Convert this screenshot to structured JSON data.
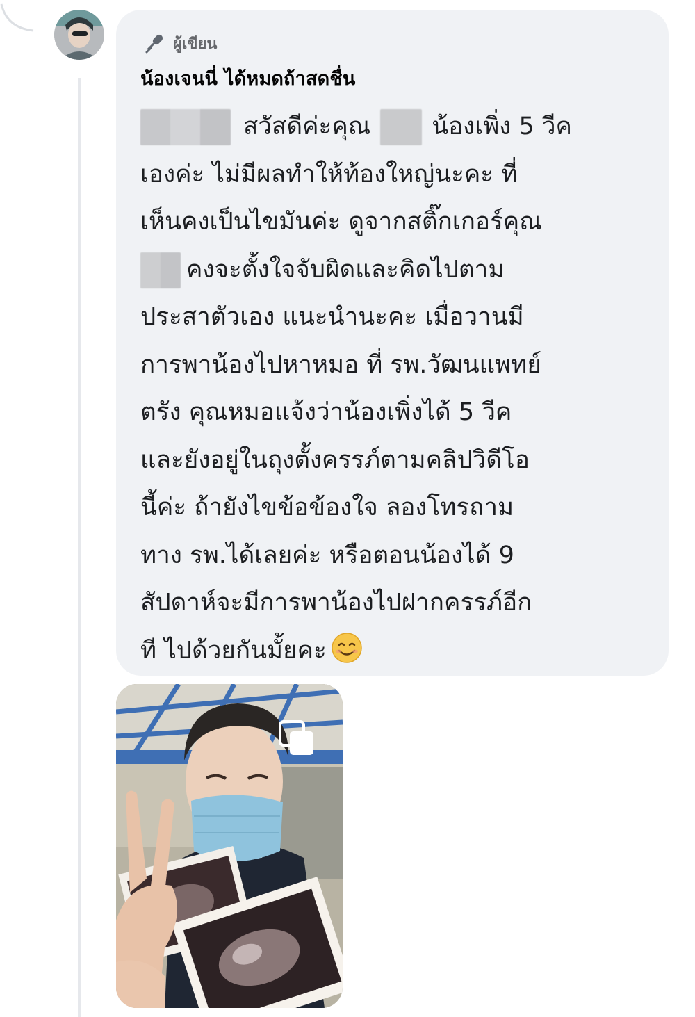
{
  "comment": {
    "author_badge": "ผู้เขียน",
    "author_name": "น้องเจนนี่ ได้หมดถ้าสดชื่น",
    "lines": [
      {
        "before_redaction": "",
        "text": "สวัสดีค่ะคุณ"
      },
      {
        "text": "น้องเพิ่ง 5 วีค"
      },
      {
        "text": "เองค่ะ ไม่มีผลทำให้ท้องใหญ่นะคะ ที่"
      },
      {
        "text": "เห็นคงเป็นไขมันค่ะ ดูจากสติ๊กเกอร์คุณ"
      },
      {
        "text": "คงจะตั้งใจจับผิดและคิดไปตาม"
      },
      {
        "text": "ประสาตัวเอง แนะนำนะคะ เมื่อวานมี"
      },
      {
        "text": "การพาน้องไปหาหมอ ที่ รพ.วัฒนแพทย์"
      },
      {
        "text": "ตรัง คุณหมอแจ้งว่าน้องเพิ่งได้ 5 วีค"
      },
      {
        "text": "และยังอยู่ในถุงตั้งครรภ์ตามคลิปวิดีโอ"
      },
      {
        "text": "นี้ค่ะ ถ้ายังไขข้อข้องใจ ลองโทรถาม"
      },
      {
        "text": "ทาง รพ.ได้เลยค่ะ หรือตอนน้องได้ 9"
      },
      {
        "text": "สัปดาห์จะมีการพาน้องไปฝากครรภ์อีก"
      },
      {
        "text": "ที ไปด้วยกันมั้ยคะ"
      }
    ],
    "emoji": "smiling-face-icon"
  },
  "attachment": {
    "type": "photo",
    "overlay_icon": "gallery-icon"
  },
  "colors": {
    "bubble": "#f0f2f5",
    "text": "#1c1e21",
    "muted": "#65676b"
  }
}
